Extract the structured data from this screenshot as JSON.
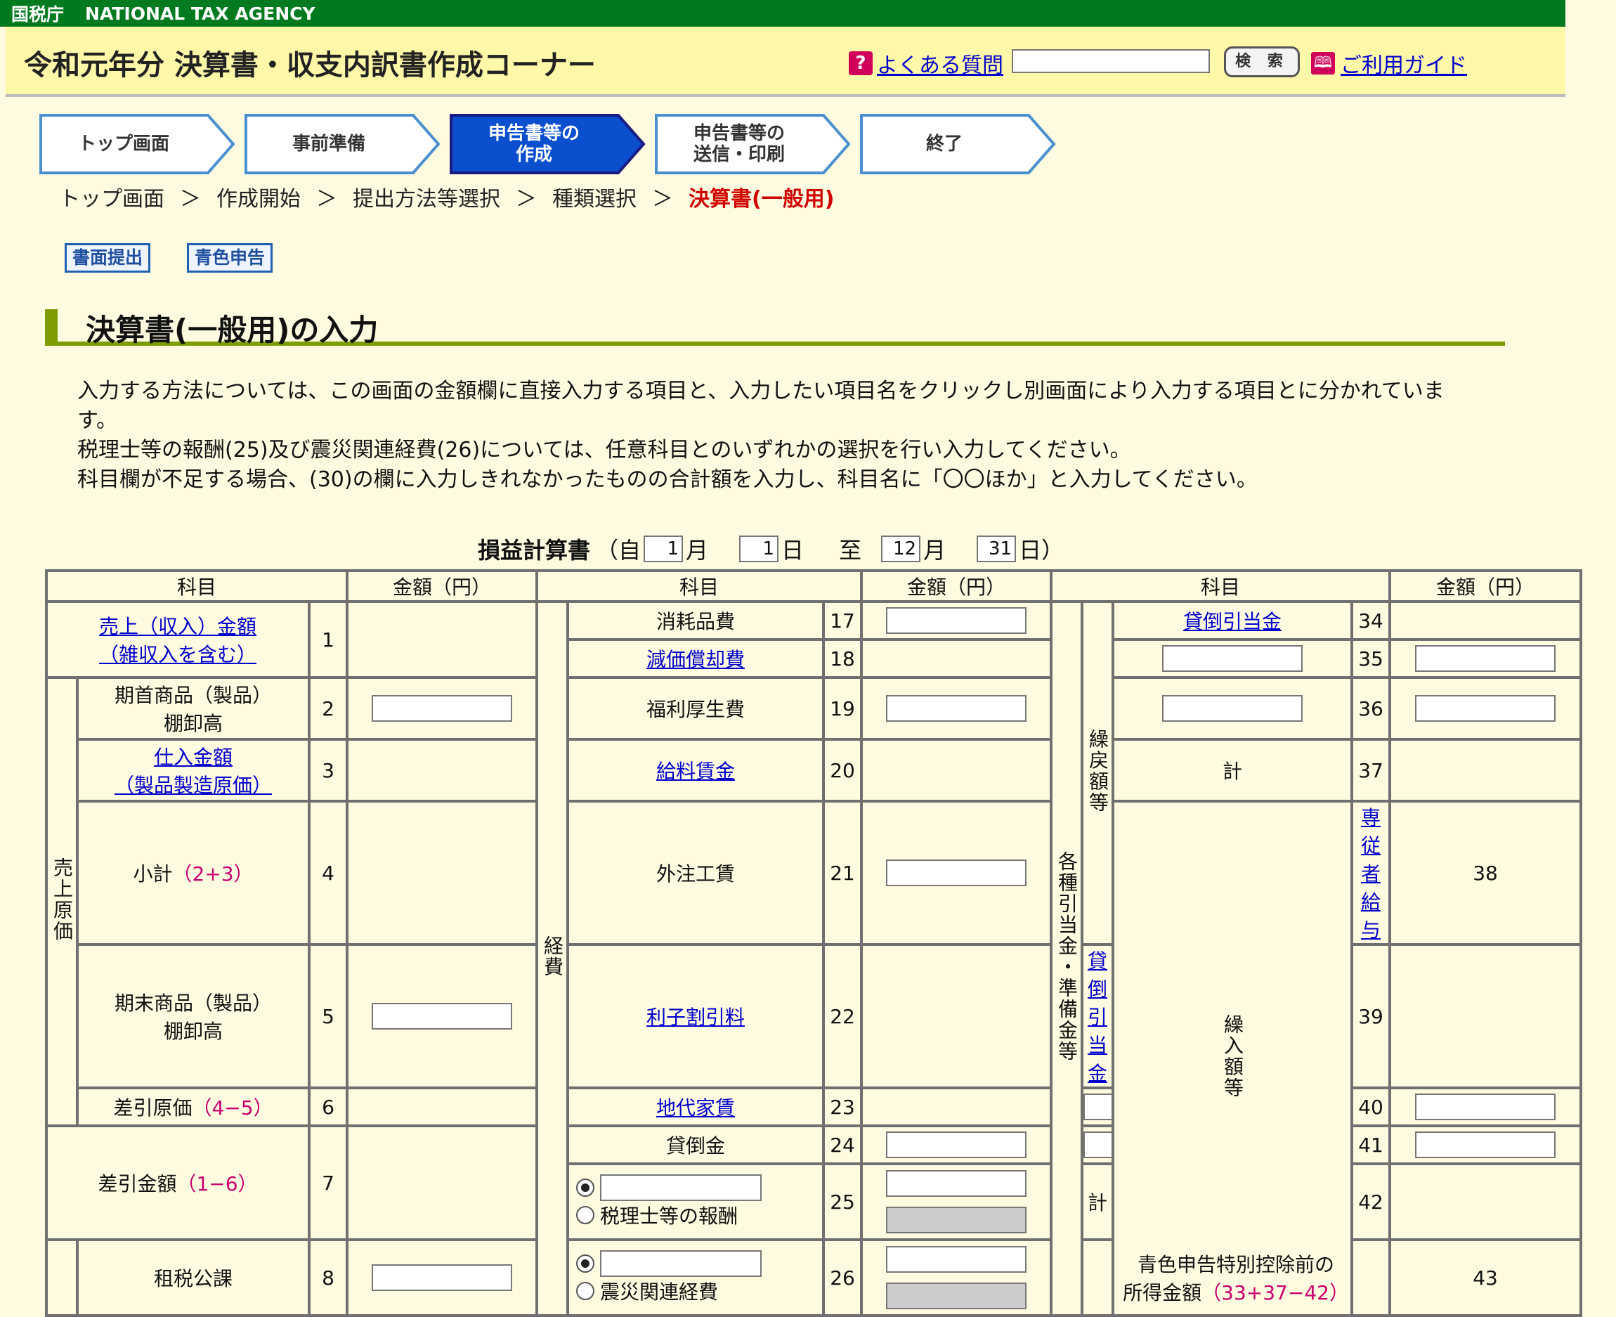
{
  "agency": {
    "jp": "国税庁",
    "en": "NATIONAL TAX AGENCY"
  },
  "header": {
    "title": "令和元年分 決算書・収支内訳書作成コーナー",
    "faq_icon": "?",
    "faq_label": "よくある質問",
    "search_placeholder": "",
    "search_button": "検 索",
    "guide_label": "ご利用ガイド"
  },
  "steps": [
    {
      "label": "トップ画面",
      "active": false
    },
    {
      "label": "事前準備",
      "active": false
    },
    {
      "label": "申告書等の\n作成",
      "active": true
    },
    {
      "label": "申告書等の\n送信・印刷",
      "active": false
    },
    {
      "label": "終了",
      "active": false
    }
  ],
  "breadcrumb": {
    "items": [
      "トップ画面",
      "＞",
      "作成開始",
      "＞",
      "提出方法等選択",
      "＞",
      "種類選択",
      "＞"
    ],
    "current": "決算書(一般用)"
  },
  "tags": {
    "paper": "書面提出",
    "blue": "青色申告"
  },
  "section_title": "決算書(一般用)の入力",
  "description": [
    "入力する方法については、この画面の金額欄に直接入力する項目と、入力したい項目名をクリックし別画面により入力する項目とに分かれています。",
    "税理士等の報酬(25)及び震災関連経費(26)については、任意科目とのいずれかの選択を行い入力してください。",
    "科目欄が不足する場合、(30)の欄に入力しきれなかったものの合計額を入力し、科目名に「〇〇ほか」と入力してください。"
  ],
  "period": {
    "label": "損益計算書",
    "open": "（自",
    "from_month": "1",
    "month_unit": "月",
    "from_day": "1",
    "day_unit": "日",
    "to_label": "至",
    "to_month": "12",
    "to_day": "31",
    "close": "日）"
  },
  "table": {
    "h_item": "科目",
    "h_amount": "金額（円）",
    "uriage": "売上（収入）金額",
    "uriage2": "（雑収入を含む）",
    "genka_group": "売上原価",
    "kishu": "期首商品（製品）",
    "kishu2": "棚卸高",
    "shiire": "仕入金額",
    "shiire2": "（製品製造原価）",
    "shokei": "小計",
    "shokei_f": "（2+3）",
    "kimatsu": "期末商品（製品）",
    "kimatsu2": "棚卸高",
    "sashihiki_genka": "差引原価",
    "sashihiki_genka_f": "（4−5）",
    "sashihiki_kingaku": "差引金額",
    "sashihiki_kingaku_f": "（1−6）",
    "sozei": "租税公課",
    "keihi_group": "経費",
    "shomohin": "消耗品費",
    "genka_shokyaku": "減価償却費",
    "fukuri": "福利厚生費",
    "kyuryo": "給料賃金",
    "gaichu": "外注工賃",
    "rishi": "利子割引料",
    "chidai": "地代家賃",
    "kashidaore": "貸倒金",
    "zeirishi": "税理士等の報酬",
    "shinsai": "震災関連経費",
    "hikiate_group": "各種引当金・準備金等",
    "kurimodoshi_group": "繰戻額等",
    "kuriire_group": "繰入額等",
    "kashidaore_hikiate": "貸倒引当金",
    "kei": "計",
    "senju": "専従者給与",
    "aoiro": "青色申告特別控除前の",
    "aoiro2": "所得金額",
    "aoiro_f": "（33+37−42）",
    "n": [
      "1",
      "2",
      "3",
      "4",
      "5",
      "6",
      "7",
      "8",
      "17",
      "18",
      "19",
      "20",
      "21",
      "22",
      "23",
      "24",
      "25",
      "26",
      "34",
      "35",
      "36",
      "37",
      "38",
      "39",
      "40",
      "41",
      "42",
      "43"
    ]
  }
}
